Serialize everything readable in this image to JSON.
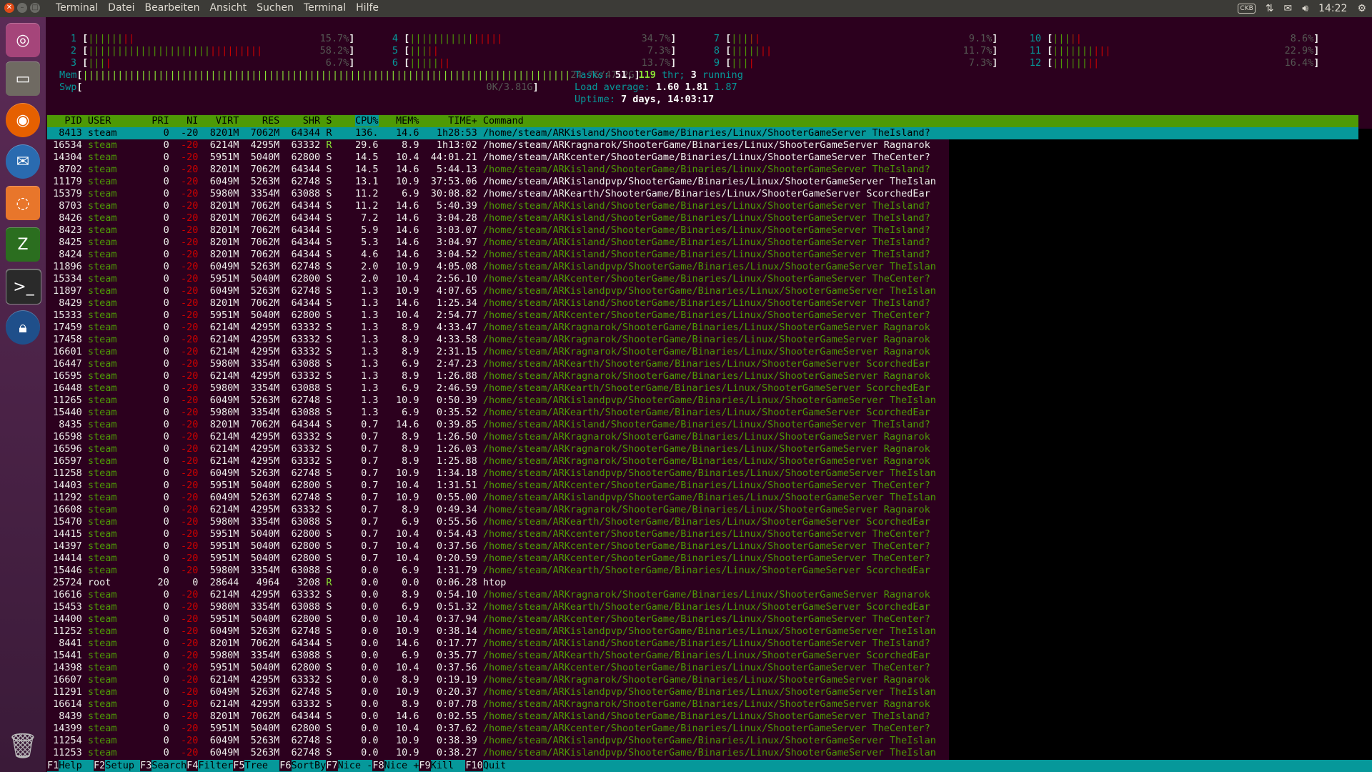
{
  "topbar": {
    "menus": [
      "Terminal",
      "Datei",
      "Bearbeiten",
      "Ansicht",
      "Suchen",
      "Terminal",
      "Hilfe"
    ],
    "keyboard": "CKB",
    "time": "14:22"
  },
  "launcher": {
    "icons": [
      "ubuntu-dash-icon",
      "files-icon",
      "firefox-icon",
      "thunderbird-icon",
      "software-icon",
      "filezilla-icon",
      "terminal-icon",
      "lock-icon",
      "trash-icon"
    ]
  },
  "htop": {
    "cpus": [
      {
        "n": "1",
        "bar": "||||||||",
        "pct": "15.7%"
      },
      {
        "n": "2",
        "bar": "||||||||||||||||||||||||||||||",
        "pct": "58.2%"
      },
      {
        "n": "3",
        "bar": "||||",
        "pct": "6.7%"
      },
      {
        "n": "4",
        "bar": "||||||||||||||||",
        "pct": "34.7%"
      },
      {
        "n": "5",
        "bar": "|||||",
        "pct": "7.3%"
      },
      {
        "n": "6",
        "bar": "|||||||",
        "pct": "13.7%"
      },
      {
        "n": "7",
        "bar": "|||||",
        "pct": "9.1%"
      },
      {
        "n": "8",
        "bar": "|||||||",
        "pct": "11.7%"
      },
      {
        "n": "9",
        "bar": "||||",
        "pct": "7.3%"
      },
      {
        "n": "10",
        "bar": "|||||",
        "pct": "8.6%"
      },
      {
        "n": "11",
        "bar": "||||||||||",
        "pct": "22.9%"
      },
      {
        "n": "12",
        "bar": "||||||||",
        "pct": "16.4%"
      }
    ],
    "mem_label": "Mem",
    "mem_bar": "||||||||||||||||||||||||||||||||||||||||||||||||||||||||||||||||||||||||||||||||||||",
    "mem_value": "24.7G/47.2G",
    "swp_label": "Swp",
    "swp_value": "0K/3.81G",
    "tasks_label": "Tasks:",
    "tasks": "51",
    "thr": "119",
    "thr_label": "thr;",
    "running": "3",
    "running_label": "running",
    "load_label": "Load average:",
    "load1": "1.60",
    "load5": "1.81",
    "load15": "1.87",
    "uptime_label": "Uptime:",
    "uptime": "7 days, 14:03:17",
    "columns": [
      "PID",
      "USER",
      "PRI",
      "NI",
      "VIRT",
      "RES",
      "SHR",
      "S",
      "CPU%",
      "MEM%",
      "TIME+",
      "Command"
    ],
    "processes": [
      [
        "8413",
        "steam",
        "0",
        "-20",
        "8201M",
        "7062M",
        "64344",
        "R",
        "136.",
        "14.6",
        "1h28:53",
        "/home/steam/ARKisland/ShooterGame/Binaries/Linux/ShooterGameServer TheIsland?"
      ],
      [
        "16534",
        "steam",
        "0",
        "-20",
        "6214M",
        "4295M",
        "63332",
        "R",
        "29.6",
        "8.9",
        "1h13:02",
        "/home/steam/ARKragnarok/ShooterGame/Binaries/Linux/ShooterGameServer Ragnarok"
      ],
      [
        "14304",
        "steam",
        "0",
        "-20",
        "5951M",
        "5040M",
        "62800",
        "S",
        "14.5",
        "10.4",
        "44:01.21",
        "/home/steam/ARKcenter/ShooterGame/Binaries/Linux/ShooterGameServer TheCenter?"
      ],
      [
        "8702",
        "steam",
        "0",
        "-20",
        "8201M",
        "7062M",
        "64344",
        "S",
        "14.5",
        "14.6",
        "5:44.13",
        "/home/steam/ARKisland/ShooterGame/Binaries/Linux/ShooterGameServer TheIsland?"
      ],
      [
        "11179",
        "steam",
        "0",
        "-20",
        "6049M",
        "5263M",
        "62748",
        "S",
        "13.1",
        "10.9",
        "37:53.06",
        "/home/steam/ARKislandpvp/ShooterGame/Binaries/Linux/ShooterGameServer TheIslan"
      ],
      [
        "15379",
        "steam",
        "0",
        "-20",
        "5980M",
        "3354M",
        "63088",
        "S",
        "11.2",
        "6.9",
        "30:08.82",
        "/home/steam/ARKearth/ShooterGame/Binaries/Linux/ShooterGameServer ScorchedEar"
      ],
      [
        "8703",
        "steam",
        "0",
        "-20",
        "8201M",
        "7062M",
        "64344",
        "S",
        "11.2",
        "14.6",
        "5:40.39",
        "/home/steam/ARKisland/ShooterGame/Binaries/Linux/ShooterGameServer TheIsland?"
      ],
      [
        "8426",
        "steam",
        "0",
        "-20",
        "8201M",
        "7062M",
        "64344",
        "S",
        "7.2",
        "14.6",
        "3:04.28",
        "/home/steam/ARKisland/ShooterGame/Binaries/Linux/ShooterGameServer TheIsland?"
      ],
      [
        "8423",
        "steam",
        "0",
        "-20",
        "8201M",
        "7062M",
        "64344",
        "S",
        "5.9",
        "14.6",
        "3:03.07",
        "/home/steam/ARKisland/ShooterGame/Binaries/Linux/ShooterGameServer TheIsland?"
      ],
      [
        "8425",
        "steam",
        "0",
        "-20",
        "8201M",
        "7062M",
        "64344",
        "S",
        "5.3",
        "14.6",
        "3:04.97",
        "/home/steam/ARKisland/ShooterGame/Binaries/Linux/ShooterGameServer TheIsland?"
      ],
      [
        "8424",
        "steam",
        "0",
        "-20",
        "8201M",
        "7062M",
        "64344",
        "S",
        "4.6",
        "14.6",
        "3:04.52",
        "/home/steam/ARKisland/ShooterGame/Binaries/Linux/ShooterGameServer TheIsland?"
      ],
      [
        "11896",
        "steam",
        "0",
        "-20",
        "6049M",
        "5263M",
        "62748",
        "S",
        "2.0",
        "10.9",
        "4:05.08",
        "/home/steam/ARKislandpvp/ShooterGame/Binaries/Linux/ShooterGameServer TheIslan"
      ],
      [
        "15334",
        "steam",
        "0",
        "-20",
        "5951M",
        "5040M",
        "62800",
        "S",
        "2.0",
        "10.4",
        "2:56.10",
        "/home/steam/ARKcenter/ShooterGame/Binaries/Linux/ShooterGameServer TheCenter?"
      ],
      [
        "11897",
        "steam",
        "0",
        "-20",
        "6049M",
        "5263M",
        "62748",
        "S",
        "1.3",
        "10.9",
        "4:07.65",
        "/home/steam/ARKislandpvp/ShooterGame/Binaries/Linux/ShooterGameServer TheIslan"
      ],
      [
        "8429",
        "steam",
        "0",
        "-20",
        "8201M",
        "7062M",
        "64344",
        "S",
        "1.3",
        "14.6",
        "1:25.34",
        "/home/steam/ARKisland/ShooterGame/Binaries/Linux/ShooterGameServer TheIsland?"
      ],
      [
        "15333",
        "steam",
        "0",
        "-20",
        "5951M",
        "5040M",
        "62800",
        "S",
        "1.3",
        "10.4",
        "2:54.77",
        "/home/steam/ARKcenter/ShooterGame/Binaries/Linux/ShooterGameServer TheCenter?"
      ],
      [
        "17459",
        "steam",
        "0",
        "-20",
        "6214M",
        "4295M",
        "63332",
        "S",
        "1.3",
        "8.9",
        "4:33.47",
        "/home/steam/ARKragnarok/ShooterGame/Binaries/Linux/ShooterGameServer Ragnarok"
      ],
      [
        "17458",
        "steam",
        "0",
        "-20",
        "6214M",
        "4295M",
        "63332",
        "S",
        "1.3",
        "8.9",
        "4:33.58",
        "/home/steam/ARKragnarok/ShooterGame/Binaries/Linux/ShooterGameServer Ragnarok"
      ],
      [
        "16601",
        "steam",
        "0",
        "-20",
        "6214M",
        "4295M",
        "63332",
        "S",
        "1.3",
        "8.9",
        "2:31.15",
        "/home/steam/ARKragnarok/ShooterGame/Binaries/Linux/ShooterGameServer Ragnarok"
      ],
      [
        "16447",
        "steam",
        "0",
        "-20",
        "5980M",
        "3354M",
        "63088",
        "S",
        "1.3",
        "6.9",
        "2:47.23",
        "/home/steam/ARKearth/ShooterGame/Binaries/Linux/ShooterGameServer ScorchedEar"
      ],
      [
        "16595",
        "steam",
        "0",
        "-20",
        "6214M",
        "4295M",
        "63332",
        "S",
        "1.3",
        "8.9",
        "1:26.88",
        "/home/steam/ARKragnarok/ShooterGame/Binaries/Linux/ShooterGameServer Ragnarok"
      ],
      [
        "16448",
        "steam",
        "0",
        "-20",
        "5980M",
        "3354M",
        "63088",
        "S",
        "1.3",
        "6.9",
        "2:46.59",
        "/home/steam/ARKearth/ShooterGame/Binaries/Linux/ShooterGameServer ScorchedEar"
      ],
      [
        "11265",
        "steam",
        "0",
        "-20",
        "6049M",
        "5263M",
        "62748",
        "S",
        "1.3",
        "10.9",
        "0:50.39",
        "/home/steam/ARKislandpvp/ShooterGame/Binaries/Linux/ShooterGameServer TheIslan"
      ],
      [
        "15440",
        "steam",
        "0",
        "-20",
        "5980M",
        "3354M",
        "63088",
        "S",
        "1.3",
        "6.9",
        "0:35.52",
        "/home/steam/ARKearth/ShooterGame/Binaries/Linux/ShooterGameServer ScorchedEar"
      ],
      [
        "8435",
        "steam",
        "0",
        "-20",
        "8201M",
        "7062M",
        "64344",
        "S",
        "0.7",
        "14.6",
        "0:39.85",
        "/home/steam/ARKisland/ShooterGame/Binaries/Linux/ShooterGameServer TheIsland?"
      ],
      [
        "16598",
        "steam",
        "0",
        "-20",
        "6214M",
        "4295M",
        "63332",
        "S",
        "0.7",
        "8.9",
        "1:26.50",
        "/home/steam/ARKragnarok/ShooterGame/Binaries/Linux/ShooterGameServer Ragnarok"
      ],
      [
        "16596",
        "steam",
        "0",
        "-20",
        "6214M",
        "4295M",
        "63332",
        "S",
        "0.7",
        "8.9",
        "1:26.03",
        "/home/steam/ARKragnarok/ShooterGame/Binaries/Linux/ShooterGameServer Ragnarok"
      ],
      [
        "16597",
        "steam",
        "0",
        "-20",
        "6214M",
        "4295M",
        "63332",
        "S",
        "0.7",
        "8.9",
        "1:25.88",
        "/home/steam/ARKragnarok/ShooterGame/Binaries/Linux/ShooterGameServer Ragnarok"
      ],
      [
        "11258",
        "steam",
        "0",
        "-20",
        "6049M",
        "5263M",
        "62748",
        "S",
        "0.7",
        "10.9",
        "1:34.18",
        "/home/steam/ARKislandpvp/ShooterGame/Binaries/Linux/ShooterGameServer TheIslan"
      ],
      [
        "14403",
        "steam",
        "0",
        "-20",
        "5951M",
        "5040M",
        "62800",
        "S",
        "0.7",
        "10.4",
        "1:31.51",
        "/home/steam/ARKcenter/ShooterGame/Binaries/Linux/ShooterGameServer TheCenter?"
      ],
      [
        "11292",
        "steam",
        "0",
        "-20",
        "6049M",
        "5263M",
        "62748",
        "S",
        "0.7",
        "10.9",
        "0:55.00",
        "/home/steam/ARKislandpvp/ShooterGame/Binaries/Linux/ShooterGameServer TheIslan"
      ],
      [
        "16608",
        "steam",
        "0",
        "-20",
        "6214M",
        "4295M",
        "63332",
        "S",
        "0.7",
        "8.9",
        "0:49.34",
        "/home/steam/ARKragnarok/ShooterGame/Binaries/Linux/ShooterGameServer Ragnarok"
      ],
      [
        "15470",
        "steam",
        "0",
        "-20",
        "5980M",
        "3354M",
        "63088",
        "S",
        "0.7",
        "6.9",
        "0:55.56",
        "/home/steam/ARKearth/ShooterGame/Binaries/Linux/ShooterGameServer ScorchedEar"
      ],
      [
        "14415",
        "steam",
        "0",
        "-20",
        "5951M",
        "5040M",
        "62800",
        "S",
        "0.7",
        "10.4",
        "0:54.43",
        "/home/steam/ARKcenter/ShooterGame/Binaries/Linux/ShooterGameServer TheCenter?"
      ],
      [
        "14397",
        "steam",
        "0",
        "-20",
        "5951M",
        "5040M",
        "62800",
        "S",
        "0.7",
        "10.4",
        "0:37.56",
        "/home/steam/ARKcenter/ShooterGame/Binaries/Linux/ShooterGameServer TheCenter?"
      ],
      [
        "14414",
        "steam",
        "0",
        "-20",
        "5951M",
        "5040M",
        "62800",
        "S",
        "0.7",
        "10.4",
        "0:20.59",
        "/home/steam/ARKcenter/ShooterGame/Binaries/Linux/ShooterGameServer TheCenter?"
      ],
      [
        "15446",
        "steam",
        "0",
        "-20",
        "5980M",
        "3354M",
        "63088",
        "S",
        "0.0",
        "6.9",
        "1:31.79",
        "/home/steam/ARKearth/ShooterGame/Binaries/Linux/ShooterGameServer ScorchedEar"
      ],
      [
        "25724",
        "root",
        "20",
        "0",
        "28644",
        "4964",
        "3208",
        "R",
        "0.0",
        "0.0",
        "0:06.28",
        "htop"
      ],
      [
        "16616",
        "steam",
        "0",
        "-20",
        "6214M",
        "4295M",
        "63332",
        "S",
        "0.0",
        "8.9",
        "0:54.10",
        "/home/steam/ARKragnarok/ShooterGame/Binaries/Linux/ShooterGameServer Ragnarok"
      ],
      [
        "15453",
        "steam",
        "0",
        "-20",
        "5980M",
        "3354M",
        "63088",
        "S",
        "0.0",
        "6.9",
        "0:51.32",
        "/home/steam/ARKearth/ShooterGame/Binaries/Linux/ShooterGameServer ScorchedEar"
      ],
      [
        "14400",
        "steam",
        "0",
        "-20",
        "5951M",
        "5040M",
        "62800",
        "S",
        "0.0",
        "10.4",
        "0:37.94",
        "/home/steam/ARKcenter/ShooterGame/Binaries/Linux/ShooterGameServer TheCenter?"
      ],
      [
        "11252",
        "steam",
        "0",
        "-20",
        "6049M",
        "5263M",
        "62748",
        "S",
        "0.0",
        "10.9",
        "0:38.14",
        "/home/steam/ARKislandpvp/ShooterGame/Binaries/Linux/ShooterGameServer TheIslan"
      ],
      [
        "8441",
        "steam",
        "0",
        "-20",
        "8201M",
        "7062M",
        "64344",
        "S",
        "0.0",
        "14.6",
        "0:17.77",
        "/home/steam/ARKisland/ShooterGame/Binaries/Linux/ShooterGameServer TheIsland?"
      ],
      [
        "15441",
        "steam",
        "0",
        "-20",
        "5980M",
        "3354M",
        "63088",
        "S",
        "0.0",
        "6.9",
        "0:35.77",
        "/home/steam/ARKearth/ShooterGame/Binaries/Linux/ShooterGameServer ScorchedEar"
      ],
      [
        "14398",
        "steam",
        "0",
        "-20",
        "5951M",
        "5040M",
        "62800",
        "S",
        "0.0",
        "10.4",
        "0:37.56",
        "/home/steam/ARKcenter/ShooterGame/Binaries/Linux/ShooterGameServer TheCenter?"
      ],
      [
        "16607",
        "steam",
        "0",
        "-20",
        "6214M",
        "4295M",
        "63332",
        "S",
        "0.0",
        "8.9",
        "0:19.19",
        "/home/steam/ARKragnarok/ShooterGame/Binaries/Linux/ShooterGameServer Ragnarok"
      ],
      [
        "11291",
        "steam",
        "0",
        "-20",
        "6049M",
        "5263M",
        "62748",
        "S",
        "0.0",
        "10.9",
        "0:20.37",
        "/home/steam/ARKislandpvp/ShooterGame/Binaries/Linux/ShooterGameServer TheIslan"
      ],
      [
        "16614",
        "steam",
        "0",
        "-20",
        "6214M",
        "4295M",
        "63332",
        "S",
        "0.0",
        "8.9",
        "0:07.78",
        "/home/steam/ARKragnarok/ShooterGame/Binaries/Linux/ShooterGameServer Ragnarok"
      ],
      [
        "8439",
        "steam",
        "0",
        "-20",
        "8201M",
        "7062M",
        "64344",
        "S",
        "0.0",
        "14.6",
        "0:02.55",
        "/home/steam/ARKisland/ShooterGame/Binaries/Linux/ShooterGameServer TheIsland?"
      ],
      [
        "14399",
        "steam",
        "0",
        "-20",
        "5951M",
        "5040M",
        "62800",
        "S",
        "0.0",
        "10.4",
        "0:37.62",
        "/home/steam/ARKcenter/ShooterGame/Binaries/Linux/ShooterGameServer TheCenter?"
      ],
      [
        "11254",
        "steam",
        "0",
        "-20",
        "6049M",
        "5263M",
        "62748",
        "S",
        "0.0",
        "10.9",
        "0:38.39",
        "/home/steam/ARKislandpvp/ShooterGame/Binaries/Linux/ShooterGameServer TheIslan"
      ],
      [
        "11253",
        "steam",
        "0",
        "-20",
        "6049M",
        "5263M",
        "62748",
        "S",
        "0.0",
        "10.9",
        "0:38.27",
        "/home/steam/ARKislandpvp/ShooterGame/Binaries/Linux/ShooterGameServer TheIslan"
      ]
    ],
    "fkeys": [
      {
        "key": "F1",
        "label": "Help  "
      },
      {
        "key": "F2",
        "label": "Setup "
      },
      {
        "key": "F3",
        "label": "Search"
      },
      {
        "key": "F4",
        "label": "Filter"
      },
      {
        "key": "F5",
        "label": "Tree  "
      },
      {
        "key": "F6",
        "label": "SortBy"
      },
      {
        "key": "F7",
        "label": "Nice -"
      },
      {
        "key": "F8",
        "label": "Nice +"
      },
      {
        "key": "F9",
        "label": "Kill  "
      },
      {
        "key": "F10",
        "label": "Quit"
      }
    ]
  },
  "colors": {
    "bg": "#2c001e",
    "header": "#4e9a06",
    "selected": "#06989a",
    "green": "#4e9a06",
    "red": "#cc0000",
    "panel": "#3c3b37"
  }
}
